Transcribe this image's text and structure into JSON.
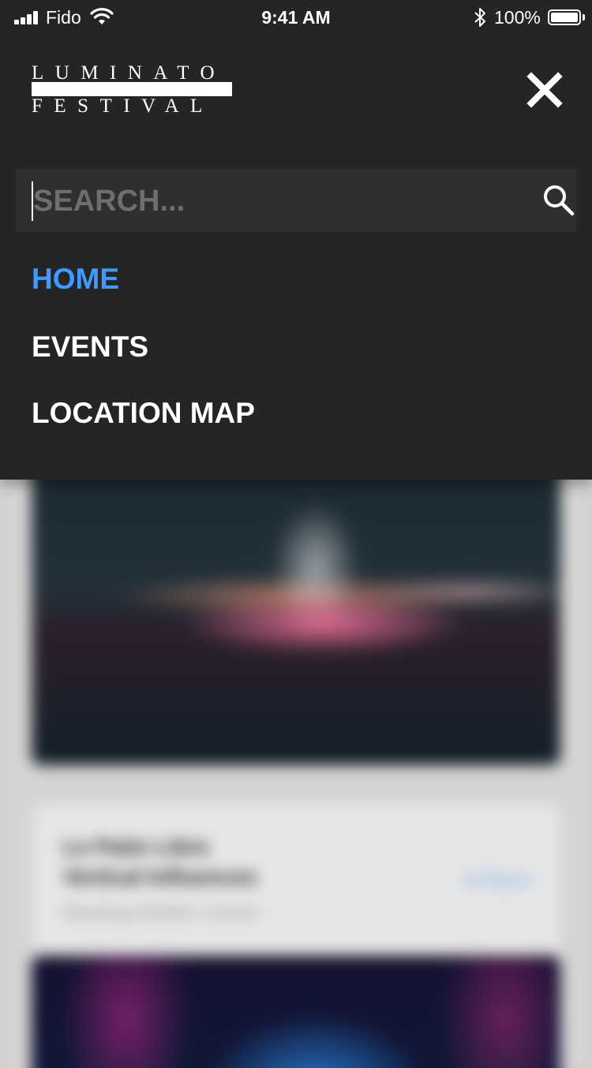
{
  "status_bar": {
    "carrier": "Fido",
    "time": "9:41 AM",
    "battery": "100%"
  },
  "logo": {
    "line1": "LUMINATO",
    "line2": "FESTIVAL"
  },
  "search": {
    "placeholder": "SEARCH..."
  },
  "nav": {
    "items": [
      {
        "label": "HOME",
        "active": true
      },
      {
        "label": "EVENTS",
        "active": false
      },
      {
        "label": "LOCATION MAP",
        "active": false
      }
    ]
  },
  "colors": {
    "menu_background": "#252525",
    "active_link": "#3d9bff"
  },
  "background_card": {
    "title_line1": "Le Patin Libre",
    "title_line2": "Vertical Influences",
    "venue": "Meeting Athletic Centre",
    "time": "9:00pm"
  }
}
